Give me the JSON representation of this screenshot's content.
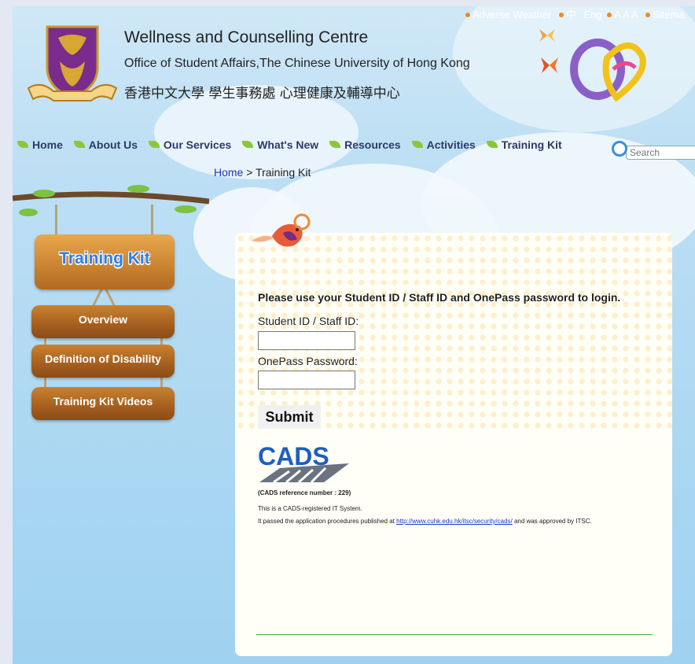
{
  "header": {
    "title_en": "Wellness and Counselling Centre",
    "subtitle": "Office of Student Affairs,The Chinese University of Hong Kong",
    "title_zh": "香港中文大學 學生事務處 心理健康及輔導中心"
  },
  "top_links": {
    "adverse_weather": "Adverse Weather",
    "lang_zh": "中",
    "lang_en": "Eng",
    "font_sizes": "A A A",
    "sitemap": "Sitema"
  },
  "nav": {
    "items": [
      "Home",
      "About Us",
      "Our Services",
      "What's New",
      "Resources",
      "Activities",
      "Training Kit"
    ]
  },
  "search": {
    "placeholder": "Search"
  },
  "breadcrumb": {
    "home": "Home",
    "separator": " > ",
    "current": "Training Kit"
  },
  "side_menu": {
    "title": "Training Kit",
    "items": [
      "Overview",
      "Definition of Disability",
      "Training Kit Videos"
    ]
  },
  "login": {
    "instruction": "Please use your Student ID / Staff ID and OnePass password to login.",
    "id_label": "Student ID / Staff ID:",
    "password_label": "OnePass Password:",
    "submit_label": "Submit"
  },
  "cads": {
    "logo_text": "CADS",
    "reference": "(CADS reference number : 229)",
    "note1": "This is a CADS-registered IT System.",
    "note2_prefix": "It passed the application procedures published at ",
    "note2_link": "http://www.cuhk.edu.hk/itsc/security/cads/",
    "note2_suffix": " and was approved by ITSC."
  },
  "colors": {
    "nav_text": "#2e3a66",
    "link": "#1a36c8",
    "sign_wood": "#a86120",
    "sign_title": "#2b7ee8",
    "sky": "#b5dbf3"
  },
  "icons": [
    "cuhk-crest-icon",
    "leaf-bullet-icon",
    "search-icon",
    "bird-icon",
    "butterfly-icon",
    "caring-campus-logo-icon",
    "cads-logo-icon"
  ]
}
